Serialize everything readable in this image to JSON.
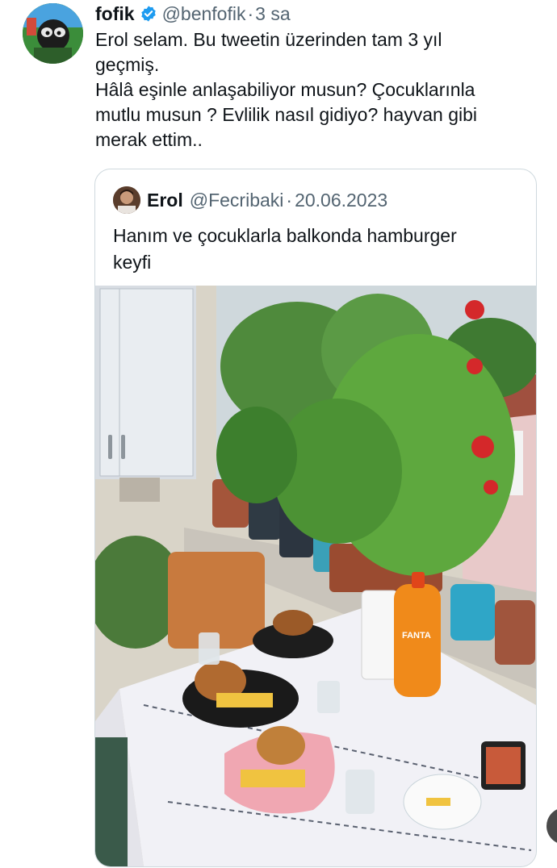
{
  "tweet": {
    "author_name": "fofik",
    "handle": "@benfofik",
    "separator": "·",
    "time": "3 sa",
    "lines": [
      "Erol selam. Bu tweetin üzerinden tam 3 yıl",
      "geçmiş.",
      "Hâlâ eşinle anlaşabiliyor musun? Çocuklarınla",
      "mutlu musun ? Evlilik nasıl gidiyo? hayvan gibi",
      "merak ettim.."
    ]
  },
  "quoted": {
    "author_name": "Erol",
    "handle": "@Fecribaki",
    "separator": "·",
    "date": "20.06.2023",
    "lines": [
      "Hanım ve çocuklarla balkonda hamburger",
      "keyfi"
    ],
    "photo_bottle_label": "FANTA"
  },
  "colors": {
    "text": "#0f1419",
    "muted": "#536471",
    "verified": "#1d9bf0",
    "border": "#cfd9de"
  }
}
